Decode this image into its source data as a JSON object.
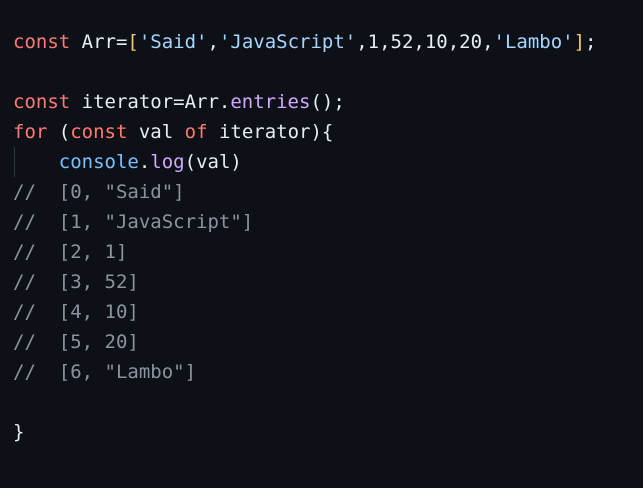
{
  "code": {
    "line1": {
      "kw": "const",
      "name": " Arr=",
      "open": "[",
      "s1": "'Said'",
      "c1": ",",
      "s2": "'JavaScript'",
      "c2": ",1,52,10,20,",
      "s3": "'Lambo'",
      "close": "]",
      "end": ";"
    },
    "line2": {
      "kw": "const",
      "a": " iterator=Arr.",
      "fn": "entries",
      "b": "();"
    },
    "line3": {
      "kw1": "for",
      "a": " (",
      "kw2": "const",
      "b": " val ",
      "kw3": "of",
      "c": " iterator){"
    },
    "line4": {
      "indent": "    ",
      "obj": "console",
      "dot": ".",
      "fn": "log",
      "args": "(val)"
    },
    "comments": [
      "//  [0, \"Said\"]",
      "//  [1, \"JavaScript\"]",
      "//  [2, 1]",
      "//  [3, 52]",
      "//  [4, 10]",
      "//  [5, 20]",
      "//  [6, \"Lambo\"]"
    ],
    "closing": "}"
  }
}
